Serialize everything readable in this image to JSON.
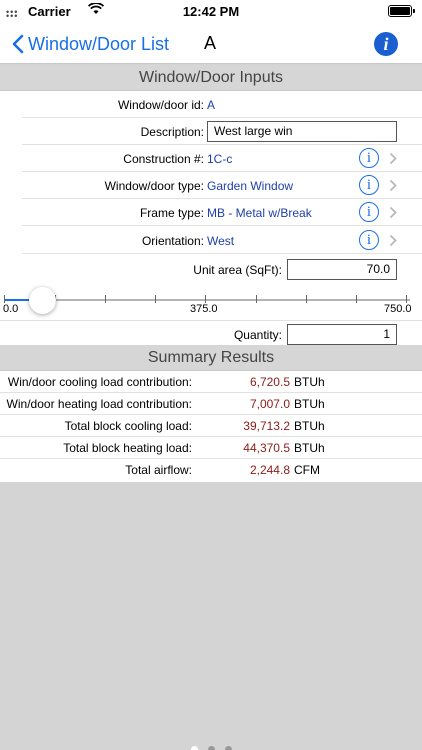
{
  "status_bar": {
    "carrier": "Carrier",
    "time": "12:42 PM"
  },
  "nav": {
    "back_label": "Window/Door List",
    "title": "A"
  },
  "inputs": {
    "header": "Window/Door Inputs",
    "id_label": "Window/door id:",
    "id_value": "A",
    "description_label": "Description:",
    "description_value": "West large win",
    "construction_label": "Construction #:",
    "construction_value": "1C-c",
    "type_label": "Window/door type:",
    "type_value": "Garden Window",
    "frame_label": "Frame type:",
    "frame_value": "MB - Metal w/Break",
    "orientation_label": "Orientation:",
    "orientation_value": "West",
    "area_label": "Unit area (SqFt):",
    "area_value": "70.0",
    "slider": {
      "min_label": "0.0",
      "mid_label": "375.0",
      "max_label": "750.0",
      "min": 0,
      "max": 750,
      "value": 70
    },
    "quantity_label": "Quantity:",
    "quantity_value": "1"
  },
  "summary": {
    "header": "Summary Results",
    "rows": [
      {
        "label": "Win/door cooling load contribution:",
        "value": "6,720.5",
        "unit": "BTUh"
      },
      {
        "label": "Win/door heating load contribution:",
        "value": "7,007.0",
        "unit": "BTUh"
      },
      {
        "label": "Total block cooling load:",
        "value": "39,713.2",
        "unit": "BTUh"
      },
      {
        "label": "Total block heating load:",
        "value": "44,370.5",
        "unit": "BTUh"
      },
      {
        "label": "Total airflow:",
        "value": "2,244.8",
        "unit": "CFM"
      }
    ]
  },
  "colors": {
    "accent": "#1a6fe8",
    "value_blue": "#1f3fa8",
    "result_red": "#8a1c1c",
    "section_gray": "#d6d6d6"
  }
}
